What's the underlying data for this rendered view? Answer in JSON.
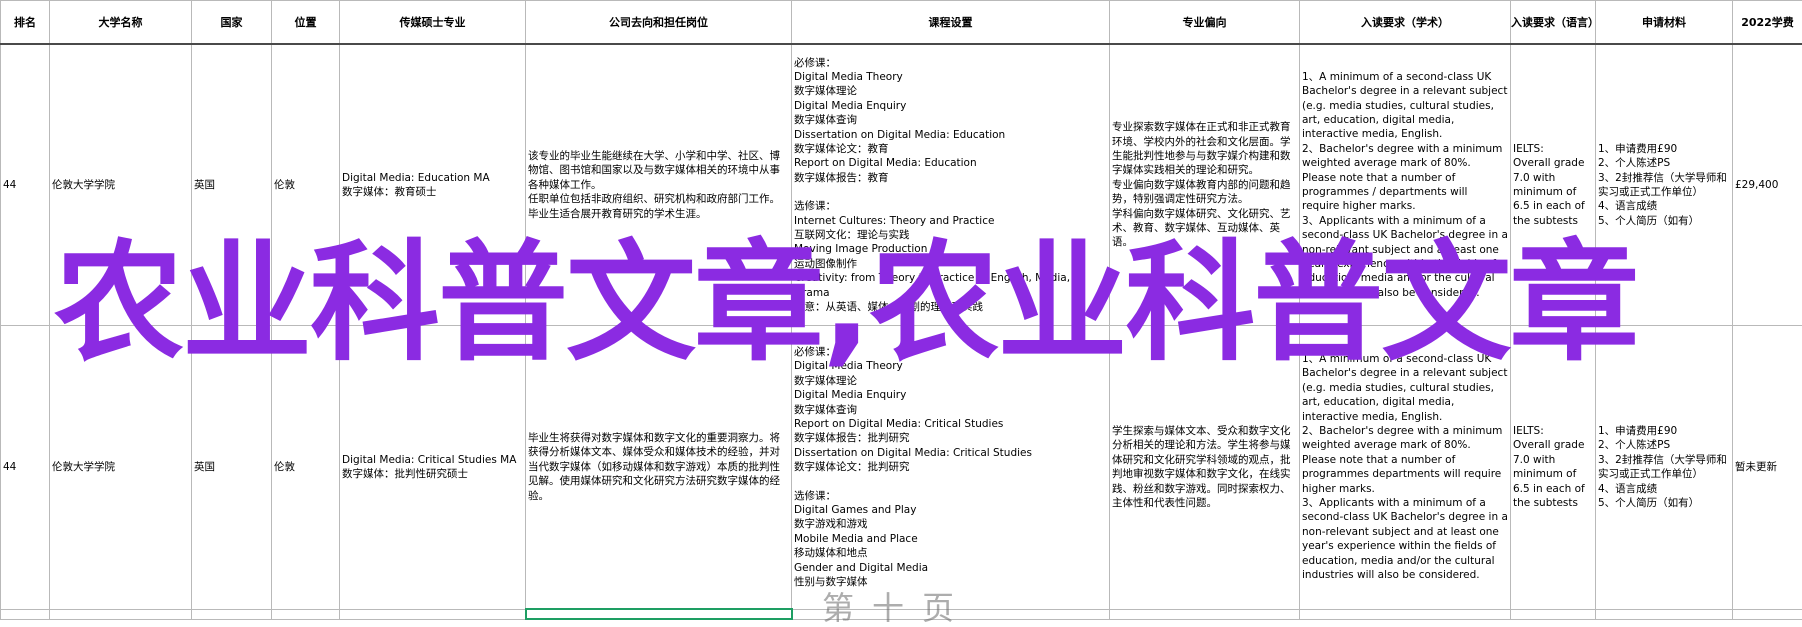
{
  "headers": [
    "排名",
    "大学名称",
    "国家",
    "位置",
    "传媒硕士专业",
    "公司去向和担任岗位",
    "课程设置",
    "专业偏向",
    "入读要求（学术）",
    "入读要求（语言）",
    "申请材料",
    "2022学费"
  ],
  "rows": [
    {
      "rank": "44",
      "university": "伦敦大学学院",
      "country": "英国",
      "location": "伦敦",
      "major": "Digital Media: Education MA\n数字媒体：教育硕士",
      "career": "该专业的毕业生能继续在大学、小学和中学、社区、博物馆、图书馆和国家以及与数字媒体相关的环境中从事各种媒体工作。\n任职单位包括非政府组织、研究机构和政府部门工作。毕业生适合展开教育研究的学术生涯。",
      "courses": [
        "必修课：\nDigital Media Theory\n数字媒体理论\nDigital Media Enquiry\n数字媒体查询\nDissertation on Digital Media: Education\n数字媒体论文：教育\nReport on Digital Media: Education\n数字媒体报告：教育",
        "选修课：\nInternet Cultures: Theory and Practice\n互联网文化：理论与实践\nMoving Image Production\n运动图像制作\nCreativity: from Theory to Practice in English, Media, Drama\n创意：从英语、媒体、戏剧的理论到实践"
      ],
      "focus": "专业探索数字媒体在正式和非正式教育环境、学校内外的社会和文化层面。学生能批判性地参与与数字媒介构建和数字媒体实践相关的理论和研究。\n专业偏向数字媒体教育内部的问题和趋势，特别强调定性研究方法。\n学科偏向数字媒体研究、文化研究、艺术、教育、数字媒体、互动媒体、英语。",
      "academic": "1、A minimum of a second-class UK Bachelor's degree in a relevant subject (e.g. media studies, cultural studies, art, education, digital media, interactive media, English.\n2、Bachelor's degree with a minimum weighted average mark of 80%. Please note that a number of programmes / departments will require higher marks.\n3、Applicants with a minimum of a second-class UK Bachelor's degree in a non-relevant subject and at least one year's experience within the fields of education, media and/or the cultural industries will also be considered.",
      "language": "IELTS:\nOverall grade 7.0 with minimum of 6.5 in each of the subtests",
      "materials": "1、申请费用£90\n2、个人陈述PS\n3、2封推荐信（大学导师和实习或正式工作单位）\n4、语言成绩\n5、个人简历（如有）",
      "tuition": "£29,400"
    },
    {
      "rank": "44",
      "university": "伦敦大学学院",
      "country": "英国",
      "location": "伦敦",
      "major": "Digital Media: Critical Studies MA\n数字媒体：批判性研究硕士",
      "career": "毕业生将获得对数字媒体和数字文化的重要洞察力。将获得分析媒体文本、媒体受众和媒体技术的经验，并对当代数字媒体（如移动媒体和数字游戏）本质的批判性见解。使用媒体研究和文化研究方法研究数字媒体的经验。",
      "courses": [
        "必修课：\nDigital Media Theory\n数字媒体理论\nDigital Media Enquiry\n数字媒体查询\nReport on Digital Media: Critical Studies\n数字媒体报告：批判研究\nDissertation on Digital Media: Critical Studies\n数字媒体论文：批判研究",
        "选修课：\nDigital Games and Play\n数字游戏和游戏\nMobile Media and Place\n移动媒体和地点\nGender and Digital Media\n性别与数字媒体"
      ],
      "focus": "学生探索与媒体文本、受众和数字文化分析相关的理论和方法。学生将参与媒体研究和文化研究学科领域的观点，批判地审视数字媒体和数字文化，在线实践、粉丝和数字游戏。同时探索权力、主体性和代表性问题。",
      "academic": "1、A minimum of a second-class UK Bachelor's degree in a relevant subject (e.g. media studies, cultural studies, art, education, digital media, interactive media, English.\n2、Bachelor's degree with a minimum weighted average mark of 80%. Please note that a number of programmes departments will require higher marks.\n3、Applicants with a minimum of a second-class UK Bachelor's degree in a non-relevant subject and at least one year's experience within the fields of education, media and/or the cultural industries will also be considered.",
      "language": "IELTS:\nOverall grade 7.0 with minimum of 6.5 in each of the subtests",
      "materials": "1、申请费用£90\n2、个人陈述PS\n3、2封推荐信（大学导师和实习或正式工作单位）\n4、语言成绩\n5、个人简历（如有）",
      "tuition": "暂未更新"
    }
  ],
  "watermark": "农业科普文章,农业科普文章",
  "faded_caption": "第十页",
  "colors": {
    "watermark": "#8b2be2",
    "selection": "#1e9e63",
    "header_rule": "#4a4a4a"
  }
}
